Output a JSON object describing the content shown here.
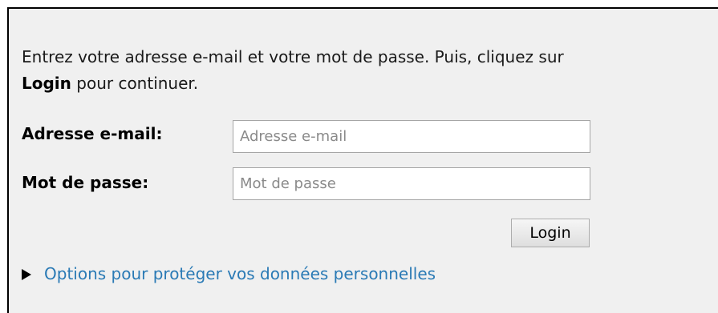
{
  "instructions": {
    "text_before": "Entrez votre adresse e-mail et votre mot de passe. Puis, cliquez sur",
    "emphasis": "Login",
    "text_after": "pour continuer."
  },
  "email": {
    "label": "Adresse e-mail:",
    "placeholder": "Adresse e-mail",
    "value": ""
  },
  "password": {
    "label": "Mot de passe:",
    "placeholder": "Mot de passe",
    "value": ""
  },
  "login_button": {
    "label": "Login"
  },
  "privacy_options": {
    "label": "Options pour protéger vos données personnelles",
    "icon": "disclosure-triangle-right"
  },
  "colors": {
    "panel_background": "#f0f0f0",
    "link": "#2a7ab5",
    "border": "#000000"
  }
}
